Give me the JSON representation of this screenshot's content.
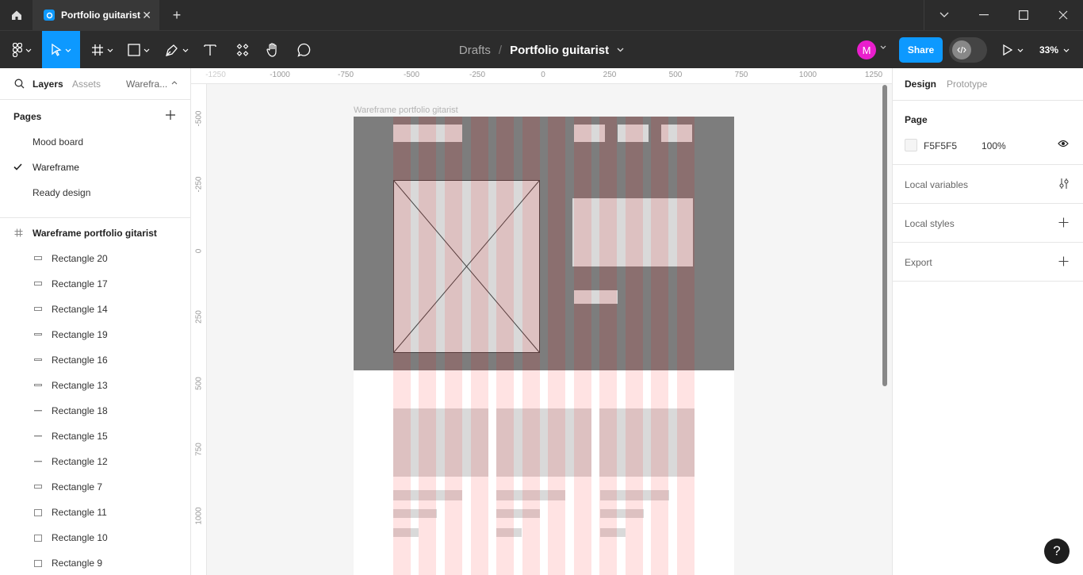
{
  "tab": {
    "title": "Portfolio guitarist"
  },
  "breadcrumb": {
    "location": "Drafts",
    "separator": "/",
    "file": "Portfolio guitarist"
  },
  "toolbar": {
    "avatar_initial": "M",
    "share_label": "Share",
    "zoom": "33%"
  },
  "left_panel": {
    "tabs": {
      "layers": "Layers",
      "assets": "Assets",
      "page_switcher": "Warefra..."
    },
    "pages_heading": "Pages",
    "pages": [
      "Mood board",
      "Wareframe",
      "Ready design"
    ],
    "current_page": "Wareframe",
    "frame_name": "Wareframe portfolio gitarist",
    "layers": [
      "Rectangle 20",
      "Rectangle 17",
      "Rectangle 14",
      "Rectangle 19",
      "Rectangle 16",
      "Rectangle 13",
      "Rectangle 18",
      "Rectangle 15",
      "Rectangle 12",
      "Rectangle 7",
      "Rectangle 11",
      "Rectangle 10",
      "Rectangle 9"
    ]
  },
  "rulers": {
    "top": [
      "-1250",
      "-1000",
      "-750",
      "-500",
      "-250",
      "0",
      "250",
      "500",
      "750",
      "1000",
      "1250"
    ],
    "left": [
      "-500",
      "-250",
      "0",
      "250",
      "500",
      "750",
      "1000"
    ]
  },
  "canvas": {
    "frame_title": "Wareframe portfolio gitarist",
    "hero_color": "#7d7d7d",
    "block_color": "#d9d9d9"
  },
  "right_panel": {
    "tabs": {
      "design": "Design",
      "prototype": "Prototype"
    },
    "page_heading": "Page",
    "page_color": "F5F5F5",
    "page_opacity": "100%",
    "sections": [
      "Local variables",
      "Local styles",
      "Export"
    ]
  },
  "help": {
    "label": "?"
  },
  "colors": {
    "accent": "#0d99ff",
    "avatar": "#e91ecd",
    "titlebar": "#2c2c2c"
  }
}
